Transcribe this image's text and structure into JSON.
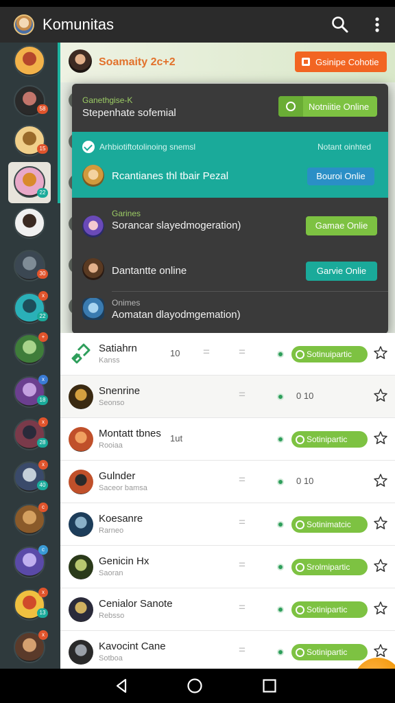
{
  "app": {
    "title": "Komunitas"
  },
  "colors": {
    "appbar": "#2b2b2b",
    "rail": "#2f3a3d",
    "accent": "#1db4a0",
    "green": "#7dc242",
    "orange": "#f26522",
    "blue": "#2a8fc6"
  },
  "icons": {
    "search": "search-icon",
    "more": "more-vert-icon",
    "star": "star-outline-icon",
    "back": "back-triangle-icon",
    "home": "home-circle-icon",
    "recents": "recents-square-icon",
    "fab": "chat-icon"
  },
  "rail": [
    {
      "badge": "",
      "dot": "",
      "colors": [
        "#f2b24a",
        "#b5472b"
      ]
    },
    {
      "badge": "58",
      "dot": "",
      "badge_color": "#e0542c",
      "colors": [
        "#2a2a2a",
        "#c2756b"
      ]
    },
    {
      "badge": "15",
      "dot": "",
      "badge_color": "#e0542c",
      "colors": [
        "#f0cf8a",
        "#9a6a2a"
      ]
    },
    {
      "badge": "22",
      "dot": "",
      "badge_color": "#1aaa9a",
      "colors": [
        "#e8a8c8",
        "#d98a2a"
      ]
    },
    {
      "badge": "",
      "dot": "",
      "badge_color": "#e0542c",
      "colors": [
        "#f0f0f0",
        "#3a2a22"
      ]
    },
    {
      "badge": "30",
      "dot": "",
      "badge_color": "#e0542c",
      "colors": [
        "#3b4752",
        "#7f8c96"
      ]
    },
    {
      "badge": "22",
      "dot": "x",
      "badge_color": "#1aaa9a",
      "dot_color": "#e0542c",
      "colors": [
        "#2ab0b8",
        "#1d4d5a"
      ]
    },
    {
      "badge": "",
      "dot": "+",
      "badge_color": "#1aaa9a",
      "dot_color": "#e0542c",
      "colors": [
        "#3f7d3a",
        "#a8d48b"
      ]
    },
    {
      "badge": "18",
      "dot": "x",
      "badge_color": "#1aaa9a",
      "dot_color": "#3a7bd5",
      "colors": [
        "#6b3f8f",
        "#c4a0e0"
      ]
    },
    {
      "badge": "28",
      "dot": "x",
      "badge_color": "#1aaa9a",
      "dot_color": "#e0542c",
      "colors": [
        "#7a3a4a",
        "#2a2a3a"
      ]
    },
    {
      "badge": "40",
      "dot": "x",
      "badge_color": "#1aaa9a",
      "dot_color": "#e0542c",
      "colors": [
        "#3a4a6a",
        "#c4cfd8"
      ]
    },
    {
      "badge": "",
      "dot": "c",
      "badge_color": "#1aaa9a",
      "dot_color": "#e0542c",
      "colors": [
        "#8a5a2a",
        "#d4a060"
      ]
    },
    {
      "badge": "",
      "dot": "c",
      "badge_color": "#1aaa9a",
      "dot_color": "#3a9bd5",
      "colors": [
        "#5a4aa8",
        "#c0b0f0"
      ]
    },
    {
      "badge": "13",
      "dot": "x",
      "badge_color": "#1aaa9a",
      "dot_color": "#e0542c",
      "colors": [
        "#f0c040",
        "#d04a2a"
      ]
    },
    {
      "badge": "",
      "dot": "x",
      "badge_color": "#1aaa9a",
      "dot_color": "#e0542c",
      "colors": [
        "#5a3a2a",
        "#d4a070"
      ]
    }
  ],
  "topcard": {
    "name": "Soamaity 2c+2",
    "button": "Gsinipe Cohotie"
  },
  "popup": {
    "header": {
      "sub": "Ganethgise-K",
      "title": "Stepenhate sofemial",
      "button": "Notniitie Online"
    },
    "selected": {
      "header": "Arhbiotiftotolinoing snemsl",
      "right": "Notant oinhted",
      "name": "Rcantianes thl tbair Pezal",
      "button": "Bouroi Onlie"
    },
    "rows": [
      {
        "sub": "Garines",
        "name": "Sorancar slayedmogeration)",
        "button": "Gamae Onlie",
        "button_color": "#7dc242"
      },
      {
        "sub": "",
        "name": "Dantantte online",
        "button": "Garvie Onlie",
        "button_color": "#1aaa9a"
      },
      {
        "sub": "Onimes",
        "name": "Aomatan dlayodmgemation)",
        "button": "",
        "button_color": ""
      }
    ]
  },
  "list": [
    {
      "name": "Satiahrn",
      "sub": "Kanss",
      "num": "10",
      "eq1": "=",
      "eq2": "=",
      "tag": "Sotinuipartic",
      "status": ""
    },
    {
      "name": "Snenrine",
      "sub": "Seonso",
      "num": "",
      "eq1": "",
      "eq2": "=",
      "tag": "",
      "status": "0 10"
    },
    {
      "name": "Montatt tbnes",
      "sub": "Rooiaa",
      "num": "1ut",
      "eq1": "",
      "eq2": "",
      "tag": "Sotinipartic",
      "status": ""
    },
    {
      "name": "Gulnder",
      "sub": "Saceor bamsa",
      "num": "",
      "eq1": "",
      "eq2": "=",
      "tag": "",
      "status": "0 10"
    },
    {
      "name": "Koesanre",
      "sub": "Rarneo",
      "num": "",
      "eq1": "",
      "eq2": "=",
      "tag": "Sotinimatcic",
      "status": ""
    },
    {
      "name": "Genicin Hx",
      "sub": "Saoran",
      "num": "",
      "eq1": "",
      "eq2": "=",
      "tag": "Srolmipartic",
      "status": ""
    },
    {
      "name": "Cenialor Sanote",
      "sub": "Rebsso",
      "num": "",
      "eq1": "",
      "eq2": "=",
      "tag": "Sotinipartic",
      "status": ""
    },
    {
      "name": "Kavocint Cane",
      "sub": "Sotboa",
      "num": "",
      "eq1": "",
      "eq2": "=",
      "tag": "Sotinipartic",
      "status": ""
    }
  ]
}
